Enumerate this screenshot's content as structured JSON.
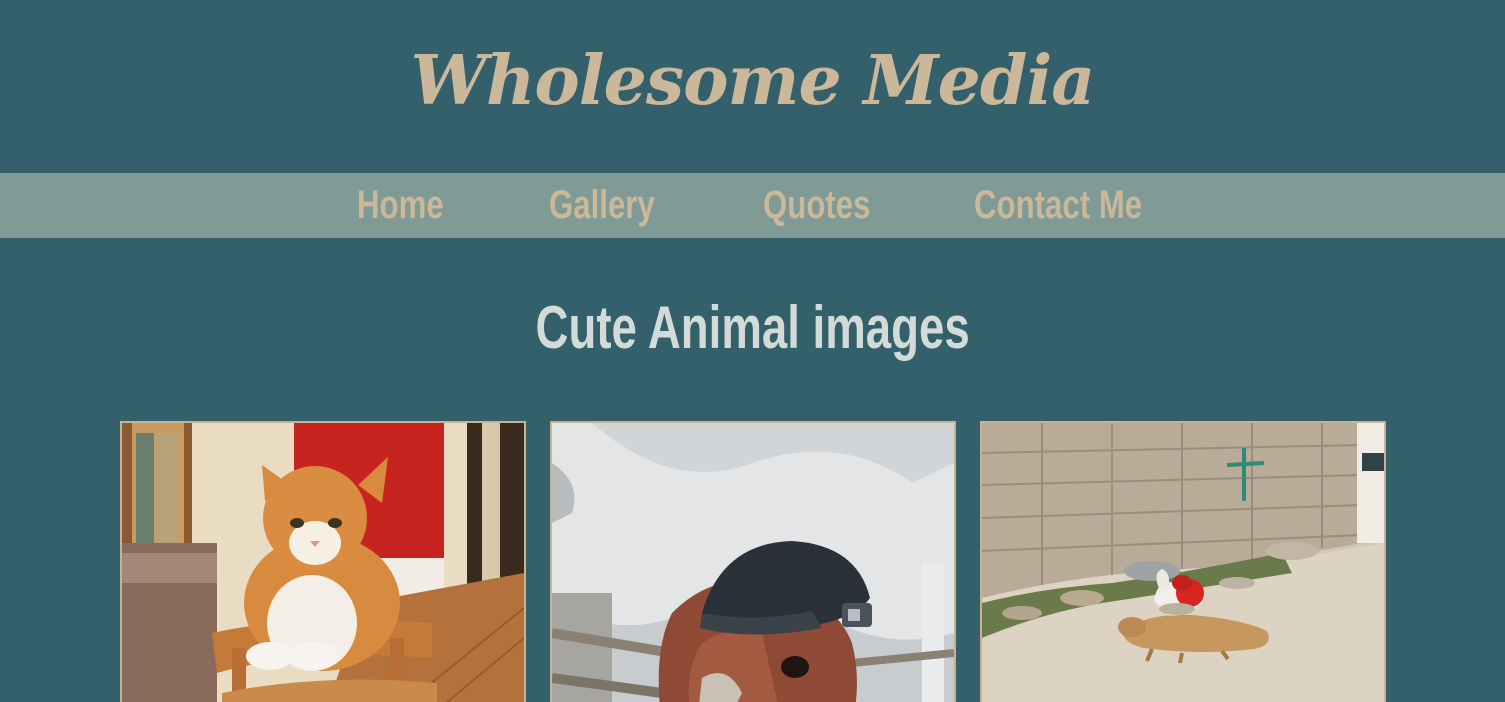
{
  "site": {
    "title": "Wholesome Media"
  },
  "nav": {
    "items": [
      {
        "label": "Home"
      },
      {
        "label": "Gallery"
      },
      {
        "label": "Quotes"
      },
      {
        "label": "Contact Me"
      }
    ]
  },
  "main": {
    "heading": "Cute Animal images",
    "images": [
      {
        "subject": "orange-and-white cat on wooden chair"
      },
      {
        "subject": "calf wearing a black cap beside a white cow"
      },
      {
        "subject": "rooster sitting on a sleeping dog by a brick wall"
      }
    ]
  },
  "colors": {
    "background": "#33606b",
    "navbar": "#809b96",
    "accent_text": "#cbb799",
    "heading_text": "#d3dbd8",
    "card_border": "#c7b394"
  }
}
